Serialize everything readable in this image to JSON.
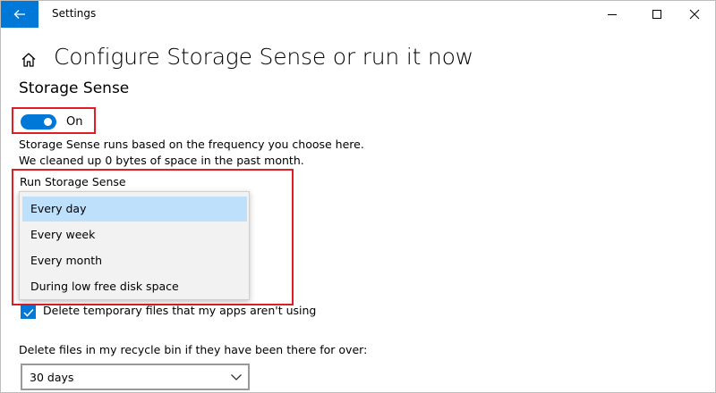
{
  "window": {
    "app_title": "Settings",
    "accent": "#0078d7",
    "highlight": "#e01c24"
  },
  "controls": {
    "back_icon": "back-arrow-icon",
    "minimize_icon": "minimize-icon",
    "maximize_icon": "maximize-icon",
    "close_icon": "close-icon"
  },
  "header": {
    "home_icon": "home-icon",
    "page_title": "Configure Storage Sense or run it now"
  },
  "storage_sense": {
    "section_title": "Storage Sense",
    "toggle_state": "On",
    "description": "Storage Sense runs based on the frequency you choose here. We cleaned up 0 bytes of space in the past month."
  },
  "run": {
    "label": "Run Storage Sense",
    "options": [
      {
        "label": "Every day",
        "selected": true
      },
      {
        "label": "Every week",
        "selected": false
      },
      {
        "label": "Every month",
        "selected": false
      },
      {
        "label": "During low free disk space",
        "selected": false
      }
    ]
  },
  "temp_files": {
    "checked": true,
    "label": "Delete temporary files that my apps aren't using"
  },
  "recycle_bin": {
    "label": "Delete files in my recycle bin if they have been there for over:",
    "value": "30 days"
  }
}
